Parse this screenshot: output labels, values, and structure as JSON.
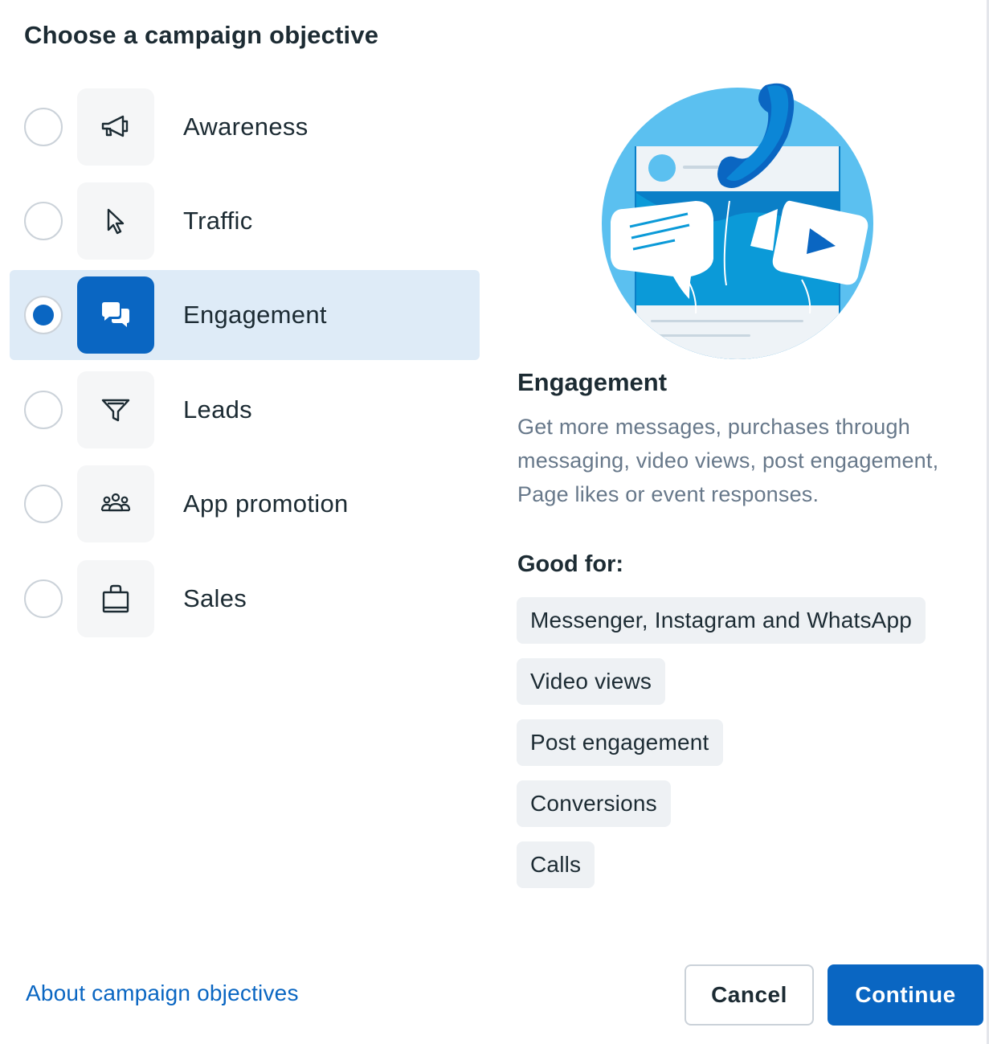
{
  "dialog": {
    "title": "Choose a campaign objective"
  },
  "objectives": [
    {
      "label": "Awareness",
      "icon": "megaphone-icon",
      "selected": false
    },
    {
      "label": "Traffic",
      "icon": "cursor-icon",
      "selected": false
    },
    {
      "label": "Engagement",
      "icon": "chat-bubbles-icon",
      "selected": true
    },
    {
      "label": "Leads",
      "icon": "funnel-icon",
      "selected": false
    },
    {
      "label": "App promotion",
      "icon": "people-group-icon",
      "selected": false
    },
    {
      "label": "Sales",
      "icon": "shopping-bag-icon",
      "selected": false
    }
  ],
  "detail": {
    "title": "Engagement",
    "description": "Get more messages, purchases through messaging, video views, post engagement, Page likes or event responses.",
    "good_for_label": "Good for:",
    "good_for": [
      "Messenger, Instagram and WhatsApp",
      "Video views",
      "Post engagement",
      "Conversions",
      "Calls"
    ]
  },
  "footer": {
    "about_link": "About campaign objectives",
    "cancel": "Cancel",
    "continue": "Continue"
  },
  "colors": {
    "accent": "#0a66c2",
    "selected_row_bg": "#deebf7",
    "chip_bg": "#eef1f4",
    "illustration_blue": "#5bc0f0"
  }
}
